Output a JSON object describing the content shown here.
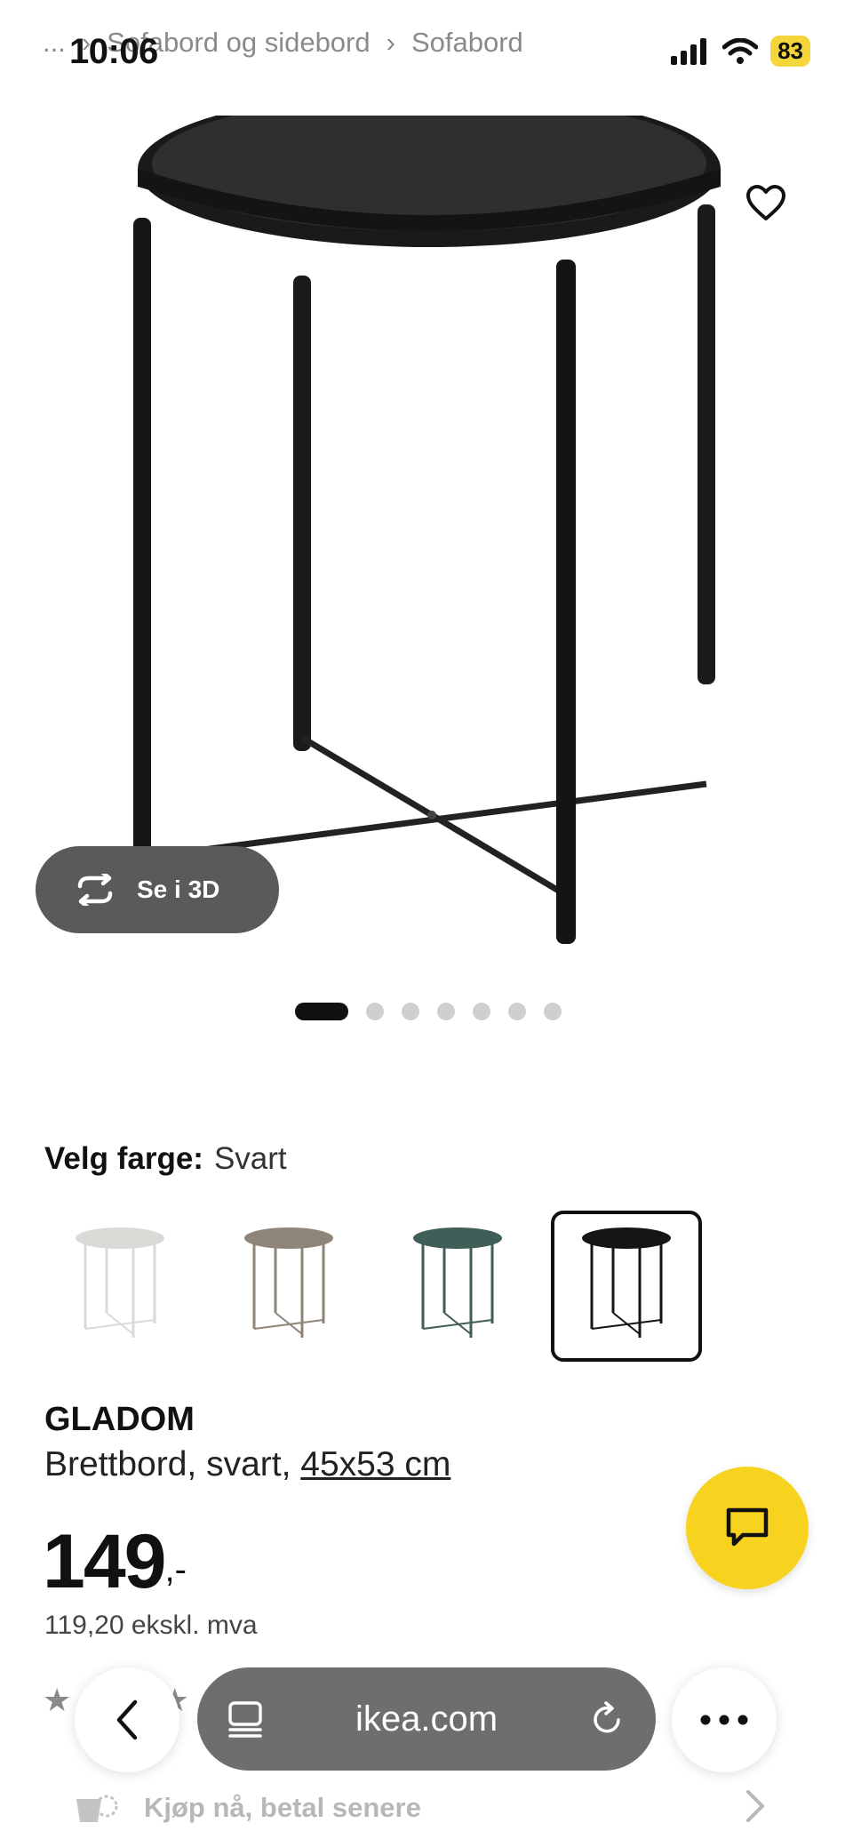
{
  "status_bar": {
    "time": "10:06",
    "battery": "83"
  },
  "breadcrumb": {
    "ellipsis": "...",
    "separator": "›",
    "items": [
      "Sofabord og sidebord",
      "Sofabord"
    ]
  },
  "hero": {
    "view_3d_label": "Se i 3D",
    "carousel_count": 7,
    "carousel_active": 1
  },
  "color_picker": {
    "label": "Velg farge:",
    "selected_value": "Svart",
    "options": [
      "white",
      "beige",
      "green",
      "black"
    ],
    "option_colors": [
      "#d9d9d6",
      "#8f8478",
      "#3f5e58",
      "#151515"
    ]
  },
  "product": {
    "name": "GLADOM",
    "description_prefix": "Brettbord, svart, ",
    "size_link": "45x53 cm",
    "price_main": "149",
    "price_suffix": ",-",
    "price_ex_vat": "119,20 ekskl. mva"
  },
  "browser": {
    "url": "ikea.com"
  },
  "payment_row": {
    "label": "Kjøp nå, betal senere"
  },
  "colors": {
    "chat_button": "#f7d31f",
    "url_pill": "#6e6e6e",
    "battery": "#f4d63b"
  }
}
